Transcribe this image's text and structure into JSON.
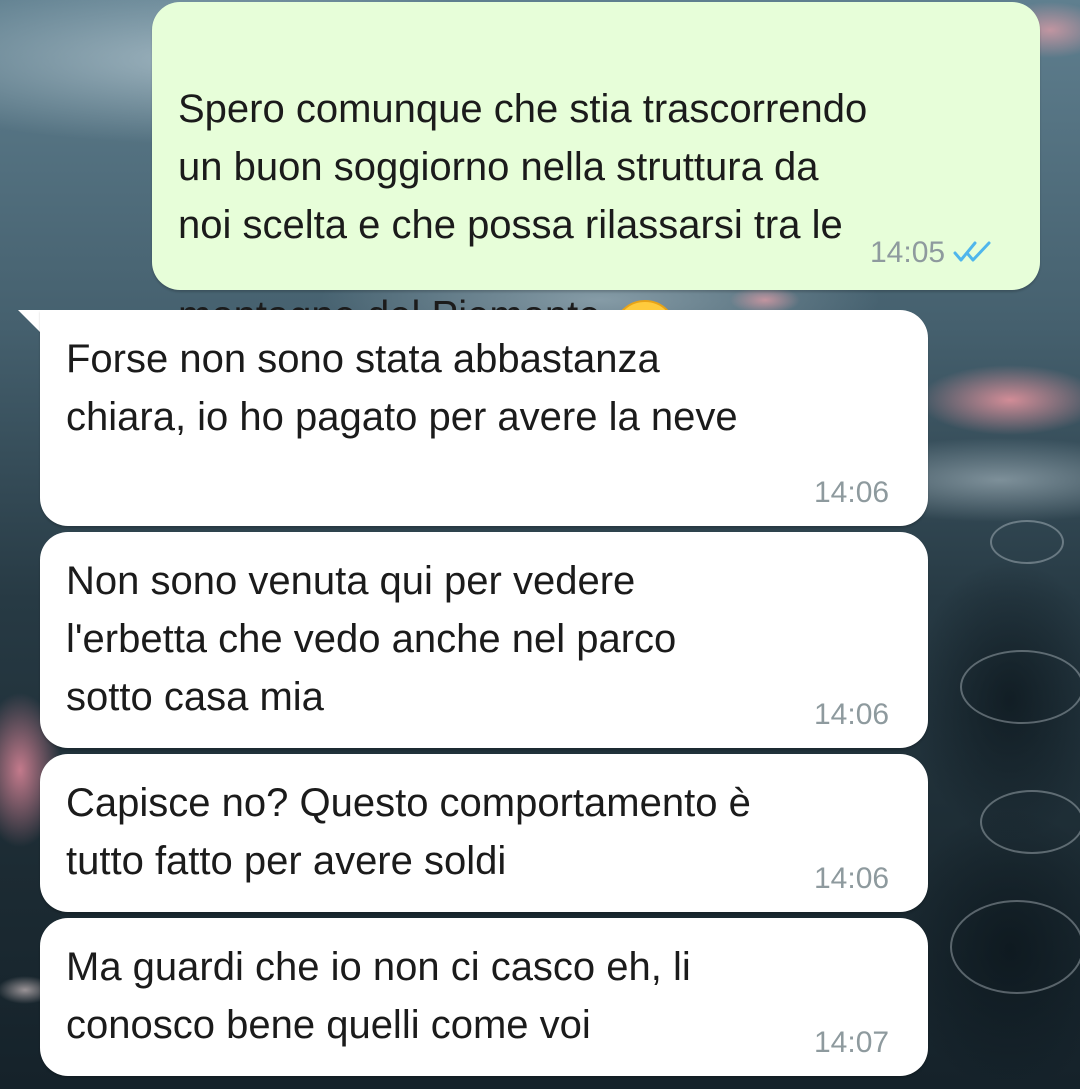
{
  "messages": [
    {
      "direction": "outgoing",
      "text": "Spero comunque che stia trascorrendo\nun buon soggiorno nella struttura da\nnoi scelta e che possa rilassarsi tra le\nmontagne del Piemonte",
      "emoji": "grinning-face-with-smiling-eyes-icon",
      "time": "14:05",
      "status": "read"
    },
    {
      "direction": "incoming",
      "text": "Forse non sono stata abbastanza\nchiara, io ho pagato per avere la neve",
      "time": "14:06"
    },
    {
      "direction": "incoming",
      "text": "Non sono venuta qui per vedere\nl'erbetta che vedo anche nel parco\nsotto casa mia",
      "time": "14:06"
    },
    {
      "direction": "incoming",
      "text": "Capisce no? Questo comportamento è\ntutto fatto per avere soldi",
      "time": "14:06"
    },
    {
      "direction": "incoming",
      "text": "Ma guardi che io non ci casco eh, li\nconosco bene quelli come voi",
      "time": "14:07"
    }
  ],
  "colors": {
    "outgoing_bubble": "#e7fed9",
    "incoming_bubble": "#ffffff",
    "read_ticks": "#4fb6ec",
    "timestamp": "#8e9a9e"
  }
}
